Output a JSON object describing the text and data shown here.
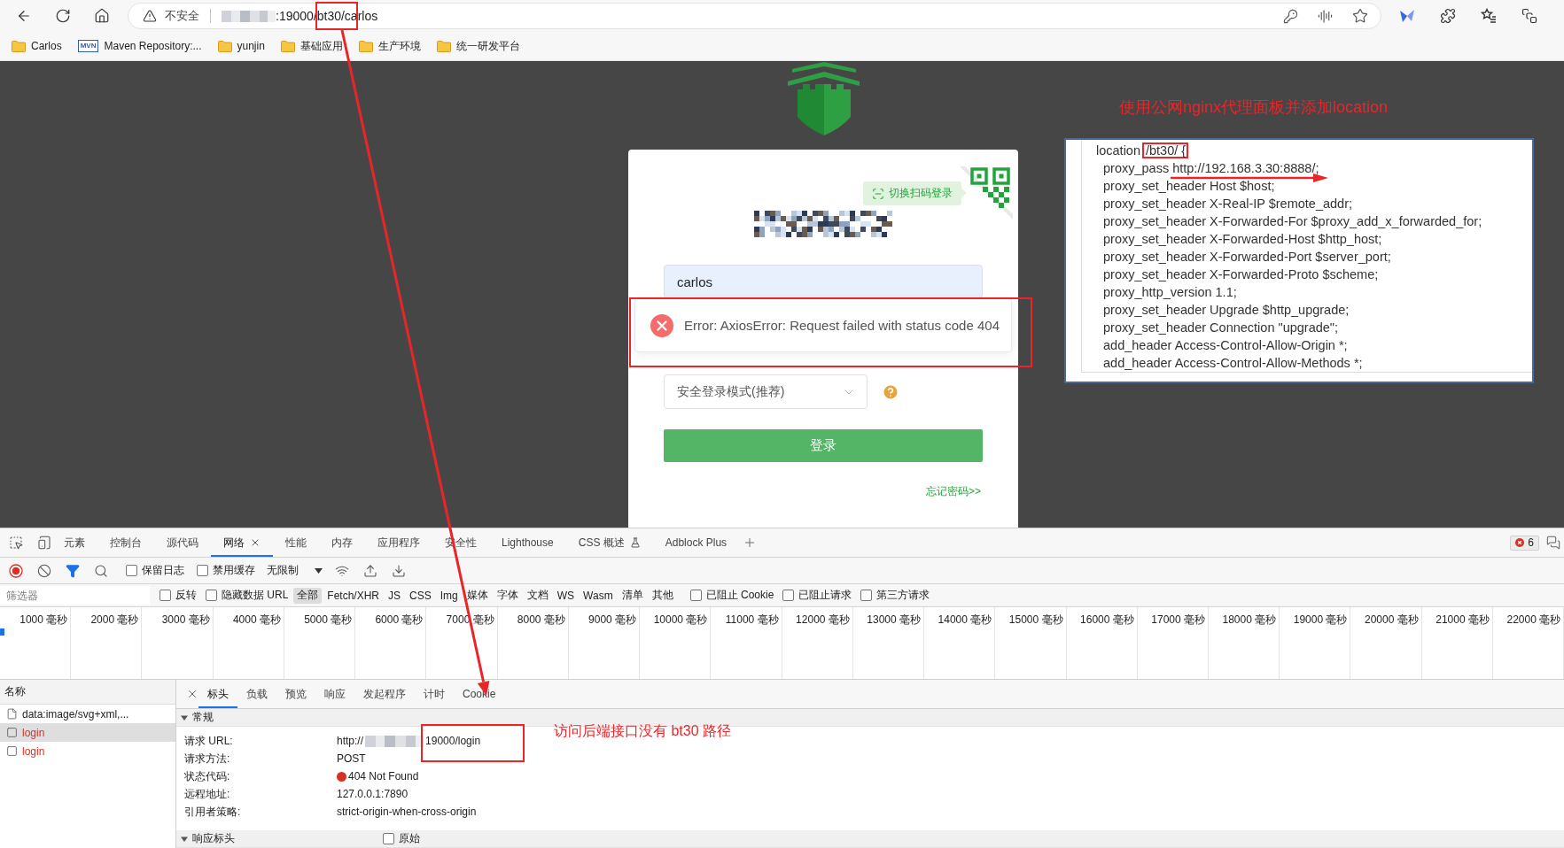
{
  "browser": {
    "address_bar": {
      "security_label": "不安全",
      "host_redacted": true,
      "url": ":19000/bt30/carlos"
    },
    "bookmarks": [
      {
        "kind": "folder",
        "label": "Carlos"
      },
      {
        "kind": "site",
        "icon_label": "MVN",
        "label": "Maven Repository:..."
      },
      {
        "kind": "folder",
        "label": "yunjin"
      },
      {
        "kind": "folder",
        "label": "基础应用"
      },
      {
        "kind": "folder",
        "label": "生产环境"
      },
      {
        "kind": "folder",
        "label": "统一研发平台"
      }
    ]
  },
  "login_card": {
    "qr_switch": "切换扫码登录",
    "title_redacted": true,
    "username": "carlos",
    "error_toast": "Error: AxiosError: Request failed with status code 404",
    "mode_select": "安全登录模式(推荐)",
    "login_button": "登录",
    "forgot_password": "忘记密码>>"
  },
  "config_panel": {
    "note": "使用公网nginx代理面板并添加location",
    "block": {
      "header": {
        "keyword": "location",
        "highlight": "/bt30/ {"
      },
      "children": [
        "proxy_pass http://192.168.3.30:8888/;",
        "proxy_set_header Host $host;",
        "proxy_set_header X-Real-IP $remote_addr;",
        "proxy_set_header X-Forwarded-For $proxy_add_x_forwarded_for;",
        "proxy_set_header X-Forwarded-Host $http_host;",
        "proxy_set_header X-Forwarded-Port $server_port;",
        "proxy_set_header X-Forwarded-Proto $scheme;",
        "proxy_http_version 1.1;",
        "proxy_set_header Upgrade $http_upgrade;",
        "proxy_set_header Connection \"upgrade\";",
        "add_header Access-Control-Allow-Origin *;",
        "add_header Access-Control-Allow-Methods *;"
      ]
    }
  },
  "devtools": {
    "tabs": [
      {
        "label": "元素",
        "selected": false
      },
      {
        "label": "控制台",
        "selected": false
      },
      {
        "label": "源代码",
        "selected": false
      },
      {
        "label": "网络",
        "selected": true,
        "closable": true
      },
      {
        "label": "性能",
        "selected": false
      },
      {
        "label": "内存",
        "selected": false
      },
      {
        "label": "应用程序",
        "selected": false
      },
      {
        "label": "安全性",
        "selected": false
      },
      {
        "label": "Lighthouse",
        "selected": false
      },
      {
        "label": "CSS 概述",
        "selected": false,
        "experimental": true
      },
      {
        "label": "Adblock Plus",
        "selected": false
      }
    ],
    "error_count": "6",
    "toolbar": {
      "recording": true,
      "checkboxes": [
        {
          "label": "保留日志",
          "checked": false
        },
        {
          "label": "禁用缓存",
          "checked": false
        }
      ],
      "throttling": "无限制"
    },
    "filter_bar": {
      "placeholder": "筛选器",
      "options": [
        {
          "label": "反转",
          "checked": false
        },
        {
          "label": "隐藏数据 URL",
          "checked": false
        }
      ],
      "types": [
        {
          "label": "全部",
          "selected": true
        },
        {
          "label": "Fetch/XHR",
          "selected": false
        },
        {
          "label": "JS",
          "selected": false
        },
        {
          "label": "CSS",
          "selected": false
        },
        {
          "label": "Img",
          "selected": false
        },
        {
          "label": "媒体",
          "selected": false
        },
        {
          "label": "字体",
          "selected": false
        },
        {
          "label": "文档",
          "selected": false
        },
        {
          "label": "WS",
          "selected": false
        },
        {
          "label": "Wasm",
          "selected": false
        },
        {
          "label": "清单",
          "selected": false
        },
        {
          "label": "其他",
          "selected": false
        }
      ],
      "blocked_options": [
        {
          "label": "已阻止 Cookie",
          "checked": false
        },
        {
          "label": "已阻止请求",
          "checked": false
        },
        {
          "label": "第三方请求",
          "checked": false
        }
      ]
    },
    "timeline_ticks": [
      "1000 毫秒",
      "2000 毫秒",
      "3000 毫秒",
      "4000 毫秒",
      "5000 毫秒",
      "6000 毫秒",
      "7000 毫秒",
      "8000 毫秒",
      "9000 毫秒",
      "10000 毫秒",
      "11000 毫秒",
      "12000 毫秒",
      "13000 毫秒",
      "14000 毫秒",
      "15000 毫秒",
      "16000 毫秒",
      "17000 毫秒",
      "18000 毫秒",
      "19000 毫秒",
      "20000 毫秒",
      "21000 毫秒",
      "22000 毫秒"
    ],
    "requests": {
      "header": "名称",
      "rows": [
        {
          "kind": "document",
          "name": "data:image/svg+xml,...",
          "failed": false,
          "selected": false
        },
        {
          "kind": "fetch",
          "name": "login",
          "failed": true,
          "selected": true
        },
        {
          "kind": "fetch",
          "name": "login",
          "failed": true,
          "selected": false
        }
      ]
    },
    "details": {
      "tabs": [
        {
          "label": "标头",
          "selected": true
        },
        {
          "label": "负载",
          "selected": false
        },
        {
          "label": "预览",
          "selected": false
        },
        {
          "label": "响应",
          "selected": false
        },
        {
          "label": "发起程序",
          "selected": false
        },
        {
          "label": "计时",
          "selected": false
        },
        {
          "label": "Cookie",
          "selected": false
        }
      ],
      "sections": [
        {
          "title": "常规",
          "expanded": true,
          "fields": [
            {
              "kind": "redacted_url",
              "label": "请求 URL:",
              "prefix": "http://",
              "suffix": "19000/login"
            },
            {
              "kind": "text",
              "label": "请求方法:",
              "value": "POST"
            },
            {
              "kind": "status",
              "label": "状态代码:",
              "value": "404 Not Found",
              "color": "#d93025"
            },
            {
              "kind": "text",
              "label": "远程地址:",
              "value": "127.0.0.1:7890"
            },
            {
              "kind": "text",
              "label": "引用者策略:",
              "value": "strict-origin-when-cross-origin"
            }
          ]
        },
        {
          "title": "响应标头",
          "expanded": true,
          "raw_toggle": {
            "label": "原始",
            "checked": false
          }
        }
      ]
    }
  },
  "annotations": {
    "backend_note": "访问后端接口没有 bt30 路径"
  }
}
